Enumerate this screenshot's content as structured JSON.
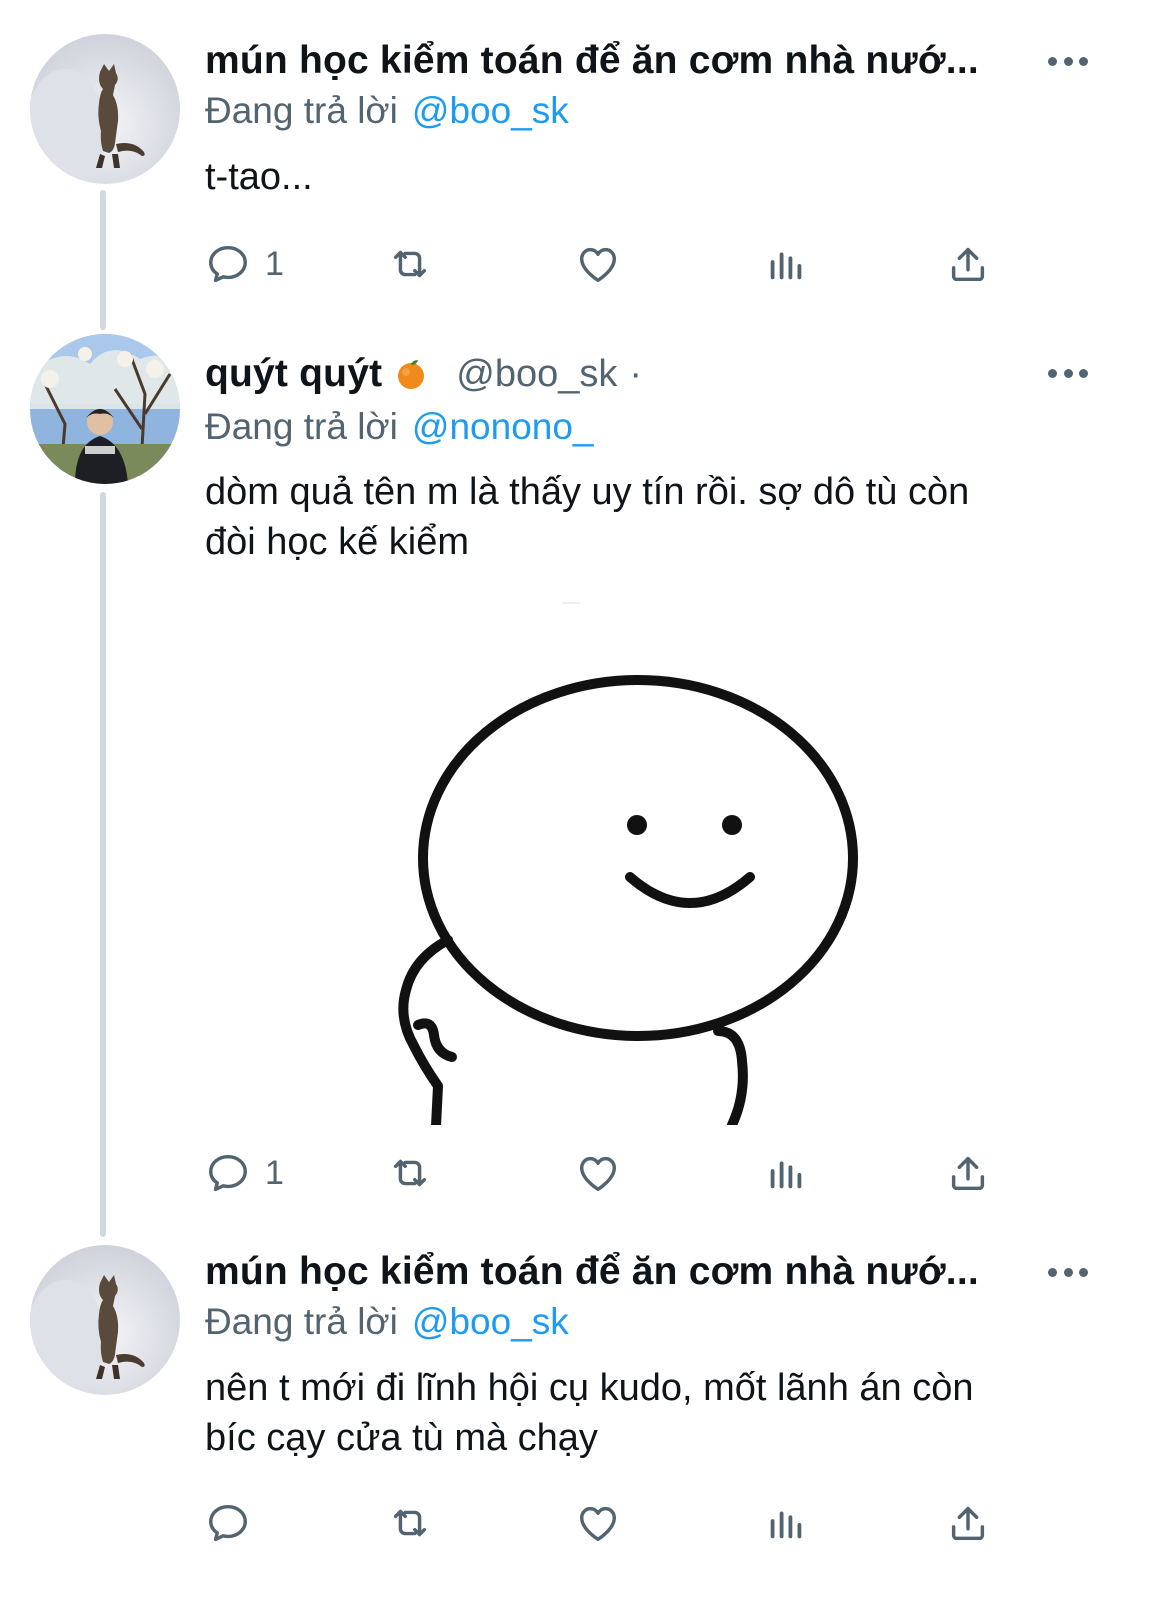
{
  "tweets": [
    {
      "display_name": "mún học kiểm toán để ăn cơm nhà nướ...",
      "reply_prefix": "Đang trả lời",
      "reply_to": "@boo_sk",
      "text": "t-tao...",
      "reply_count": "1",
      "avatar_icon": "cat-standing-avatar"
    },
    {
      "display_name": "quýt quýt",
      "emoji": "🍊",
      "handle": "@boo_sk",
      "separator": "·",
      "reply_prefix": "Đang trả lời",
      "reply_to": "@nonono_",
      "text": "dòm quả tên m là thấy uy tín rồi. sợ dô tù còn\nđòi học kế kiểm",
      "reply_count": "1",
      "avatar_icon": "person-under-tree-avatar",
      "media_icon": "smiling-blob-sticker"
    },
    {
      "display_name": "mún học kiểm toán để ăn cơm nhà nướ...",
      "reply_prefix": "Đang trả lời",
      "reply_to": "@boo_sk",
      "text": "nên t mới đi lĩnh hội cụ kudo, mốt lãnh án còn\nbíc cạy cửa tù mà chạy",
      "reply_count": "",
      "avatar_icon": "cat-standing-avatar"
    }
  ],
  "colors": {
    "text": "#0f1419",
    "secondary": "#536471",
    "link": "#1d9bf0",
    "thread_line": "#cfd9de"
  }
}
